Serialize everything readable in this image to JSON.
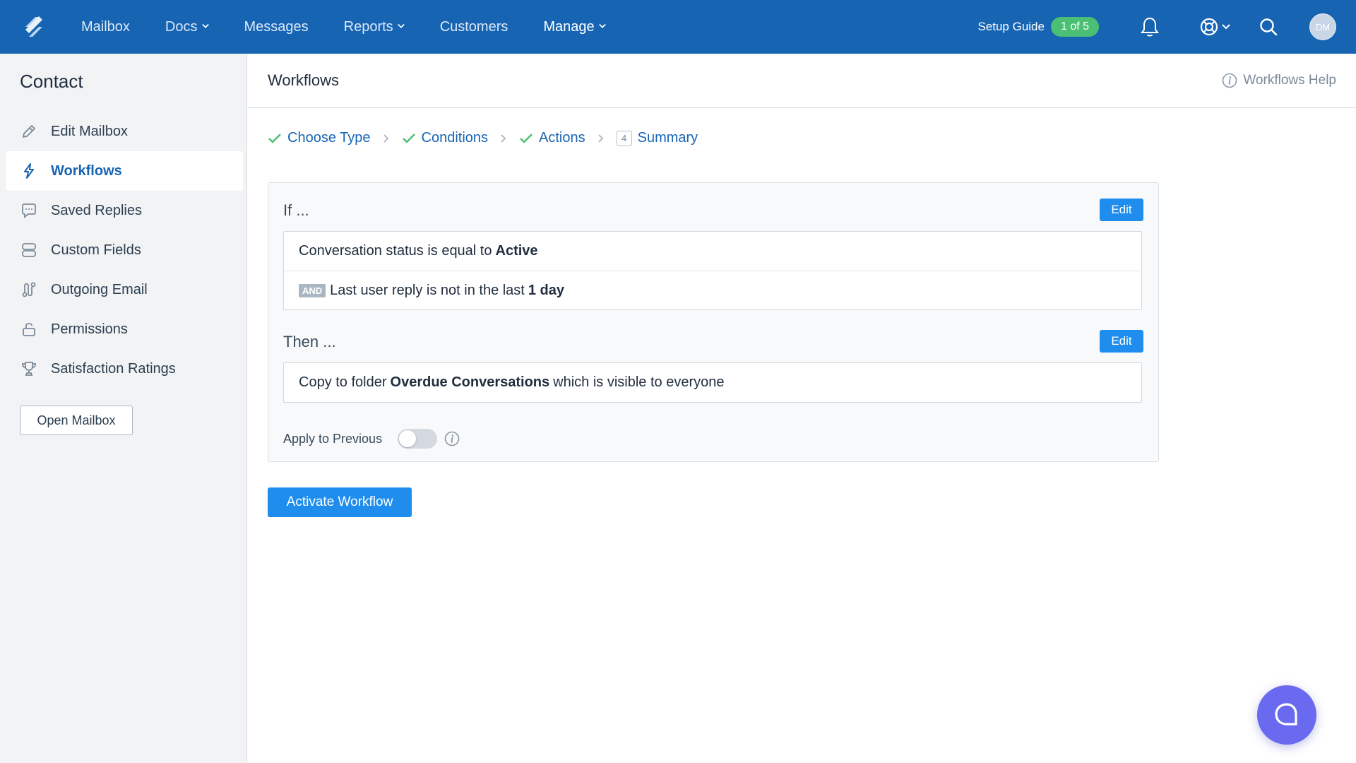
{
  "nav": {
    "items": [
      {
        "label": "Mailbox",
        "dropdown": false,
        "active": false
      },
      {
        "label": "Docs",
        "dropdown": true,
        "active": false
      },
      {
        "label": "Messages",
        "dropdown": false,
        "active": false
      },
      {
        "label": "Reports",
        "dropdown": true,
        "active": false
      },
      {
        "label": "Customers",
        "dropdown": false,
        "active": false
      },
      {
        "label": "Manage",
        "dropdown": true,
        "active": true
      }
    ],
    "setup_label": "Setup Guide",
    "setup_progress": "1 of 5",
    "avatar_initials": "DM",
    "bar_color": "#1764b3"
  },
  "sidebar": {
    "title": "Contact",
    "items": [
      {
        "label": "Edit Mailbox",
        "icon": "pencil-icon"
      },
      {
        "label": "Workflows",
        "icon": "lightning-icon",
        "active": true
      },
      {
        "label": "Saved Replies",
        "icon": "chat-bubble-icon"
      },
      {
        "label": "Custom Fields",
        "icon": "fields-icon"
      },
      {
        "label": "Outgoing Email",
        "icon": "route-icon"
      },
      {
        "label": "Permissions",
        "icon": "lock-icon"
      },
      {
        "label": "Satisfaction Ratings",
        "icon": "trophy-icon"
      }
    ],
    "open_mailbox": "Open Mailbox"
  },
  "main": {
    "title": "Workflows",
    "help": "Workflows Help",
    "steps": [
      {
        "label": "Choose Type",
        "status": "done"
      },
      {
        "label": "Conditions",
        "status": "done"
      },
      {
        "label": "Actions",
        "status": "done"
      },
      {
        "label": "Summary",
        "status": "current",
        "number": "4"
      }
    ],
    "if_label": "If ...",
    "then_label": "Then ...",
    "edit_label": "Edit",
    "conditions": [
      {
        "prefix": "",
        "text": "Conversation status is equal to",
        "value": "Active",
        "suffix": ""
      },
      {
        "prefix": "AND",
        "text": "Last user reply is not in the last",
        "value": "1 day",
        "suffix": ""
      }
    ],
    "actions": [
      {
        "text": "Copy to folder",
        "value": "Overdue Conversations",
        "suffix": "which is visible to everyone"
      }
    ],
    "apply_previous": "Apply to Previous",
    "apply_previous_on": false,
    "activate": "Activate Workflow",
    "accent": "#1f8ded",
    "success": "#4bbf73"
  }
}
